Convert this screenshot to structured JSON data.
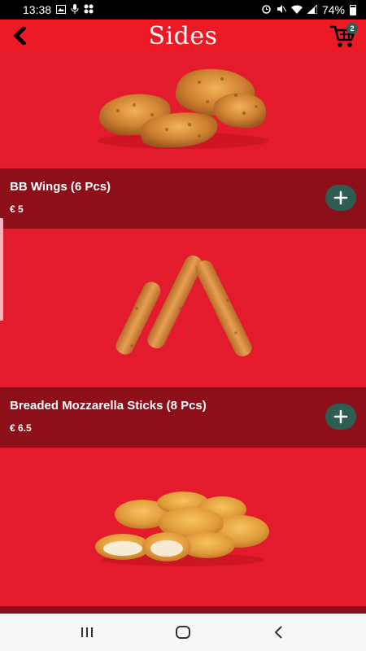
{
  "status_bar": {
    "time": "13:38",
    "battery": "74%",
    "icons": [
      "image-icon",
      "mic-icon",
      "apps-icon",
      "alarm-icon",
      "mute-icon",
      "wifi-icon",
      "signal-icon",
      "battery-icon"
    ]
  },
  "header": {
    "title": "Sides",
    "cart_count": "2",
    "colors": {
      "bar": "#ec1a24",
      "badge": "#2e5d52"
    }
  },
  "products": [
    {
      "name": "BB Wings (6 Pcs)",
      "price": "€ 5",
      "image": "chicken-wings-image"
    },
    {
      "name": "Breaded Mozzarella Sticks (8 Pcs)",
      "price": "€ 6.5",
      "image": "mozzarella-sticks-image"
    },
    {
      "name": "",
      "price": "",
      "image": "chicken-nuggets-image"
    }
  ],
  "colors": {
    "background": "#e31b2c",
    "info_bar": "#8d0f1a",
    "add_button": "#2e5d52"
  }
}
